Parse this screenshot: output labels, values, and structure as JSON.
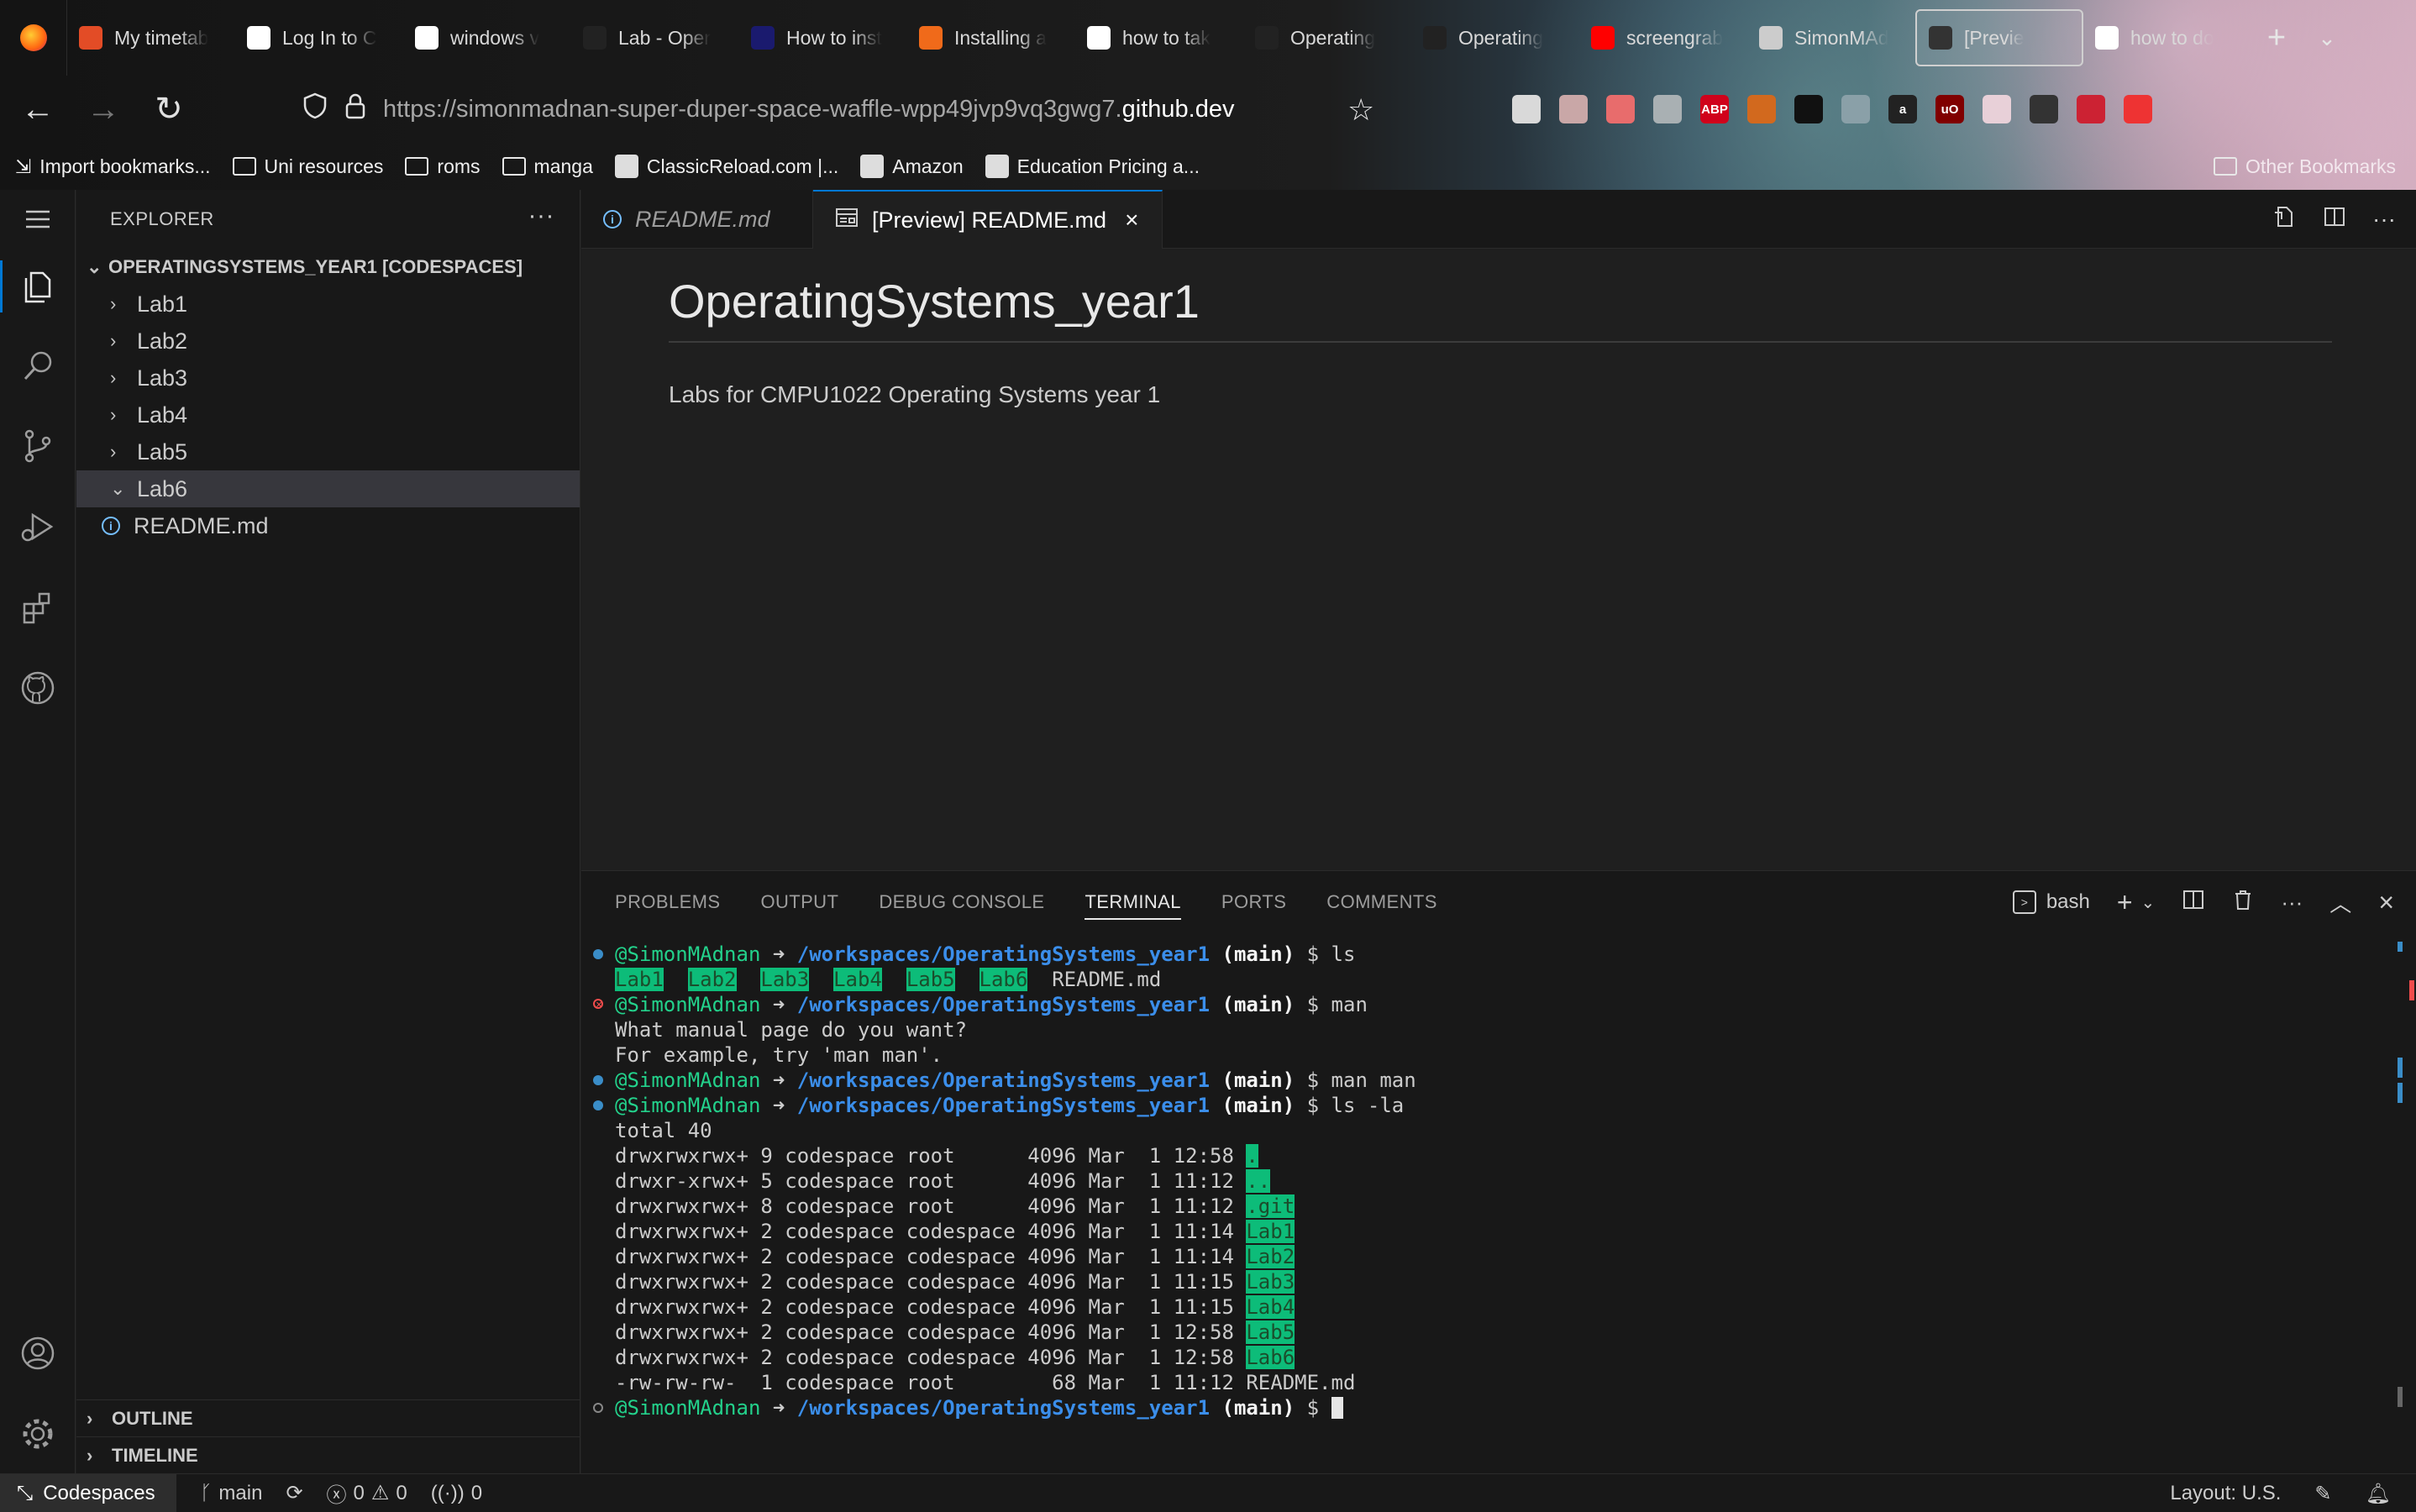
{
  "browser": {
    "tabs": [
      {
        "title": "My timetab",
        "icon": "red-bird-icon",
        "color": "#e34c26"
      },
      {
        "title": "Log In to C",
        "icon": "cisco-icon",
        "color": "#ffffff"
      },
      {
        "title": "windows v",
        "icon": "google-icon",
        "color": "#ffffff"
      },
      {
        "title": "Lab - Oper",
        "icon": "d2l-icon",
        "color": "#222222"
      },
      {
        "title": "How to inst",
        "icon": "arch-icon",
        "color": "#1a1a6e"
      },
      {
        "title": "Installing a",
        "icon": "chevron-logo-icon",
        "color": "#f06a1a"
      },
      {
        "title": "how to tak",
        "icon": "google-icon",
        "color": "#ffffff"
      },
      {
        "title": "Operating",
        "icon": "d2l-icon",
        "color": "#222222"
      },
      {
        "title": "Operating",
        "icon": "d2l-icon",
        "color": "#222222"
      },
      {
        "title": "screengrab",
        "icon": "youtube-icon",
        "color": "#ff0000"
      },
      {
        "title": "SimonMAd",
        "icon": "search-icon",
        "color": "#cccccc"
      },
      {
        "title": "[Previe",
        "icon": "github-icon",
        "color": "#333333"
      },
      {
        "title": "how to do",
        "icon": "google-icon",
        "color": "#ffffff"
      }
    ],
    "url_dim": "https://simonmadnan-super-duper-space-waffle-wpp49jvp9vq3gwg7.",
    "url_bright": "github.dev",
    "bookmarks": [
      {
        "label": "Import bookmarks...",
        "type": "import"
      },
      {
        "label": "Uni resources",
        "type": "folder"
      },
      {
        "label": "roms",
        "type": "folder"
      },
      {
        "label": "manga",
        "type": "folder"
      },
      {
        "label": "ClassicReload.com |...",
        "type": "site"
      },
      {
        "label": "Amazon",
        "type": "site"
      },
      {
        "label": "Education Pricing a...",
        "type": "site"
      }
    ],
    "other_bookmarks": "Other Bookmarks",
    "extensions": [
      {
        "label": "",
        "color": "#d9d9d9"
      },
      {
        "label": "",
        "color": "#c9a7a7"
      },
      {
        "label": "",
        "color": "#e86c6c"
      },
      {
        "label": "",
        "color": "#a9b0b3"
      },
      {
        "label": "ABP",
        "color": "#d0021b"
      },
      {
        "label": "",
        "color": "#d2691e"
      },
      {
        "label": "",
        "color": "#111111"
      },
      {
        "label": "",
        "color": "#8aa0a8"
      },
      {
        "label": "a",
        "color": "#222222"
      },
      {
        "label": "uO",
        "color": "#800000"
      },
      {
        "label": "",
        "color": "#e8d0d8"
      },
      {
        "label": "",
        "color": "#333333"
      },
      {
        "label": "",
        "color": "#cc2233"
      },
      {
        "label": "",
        "color": "#e33"
      }
    ]
  },
  "sidebar": {
    "title": "EXPLORER",
    "root": "OPERATINGSYSTEMS_YEAR1 [CODESPACES]",
    "items": [
      {
        "label": "Lab1",
        "expanded": false
      },
      {
        "label": "Lab2",
        "expanded": false
      },
      {
        "label": "Lab3",
        "expanded": false
      },
      {
        "label": "Lab4",
        "expanded": false
      },
      {
        "label": "Lab5",
        "expanded": false
      },
      {
        "label": "Lab6",
        "expanded": true
      }
    ],
    "file": "README.md",
    "outline": "OUTLINE",
    "timeline": "TIMELINE"
  },
  "editor": {
    "tabs": [
      {
        "label": "README.md",
        "active": false
      },
      {
        "label": "[Preview] README.md",
        "active": true
      }
    ],
    "preview_title": "OperatingSystems_year1",
    "preview_text": "Labs for CMPU1022 Operating Systems year 1"
  },
  "panel": {
    "tabs": [
      "PROBLEMS",
      "OUTPUT",
      "DEBUG CONSOLE",
      "TERMINAL",
      "PORTS",
      "COMMENTS"
    ],
    "active_tab": "TERMINAL",
    "shell": "bash"
  },
  "terminal": {
    "user": "@SimonMAdnan",
    "arrow": "➜",
    "path": "/workspaces/OperatingSystems_year1",
    "branch": "main",
    "dirs": [
      "Lab1",
      "Lab2",
      "Lab3",
      "Lab4",
      "Lab5",
      "Lab6"
    ],
    "readme": "README.md",
    "cmd_ls": "ls",
    "cmd_man": "man",
    "man_out_1": "What manual page do you want?",
    "man_out_2": "For example, try 'man man'.",
    "cmd_man_man": "man man",
    "cmd_ls_la": "ls -la",
    "total": "total 40",
    "listing": [
      {
        "perm": "drwxrwxrwx+ 9 codespace root      4096 Mar  1 12:58 ",
        "name": ".",
        "dir": true
      },
      {
        "perm": "drwxr-xrwx+ 5 codespace root      4096 Mar  1 11:12 ",
        "name": "..",
        "dir": true
      },
      {
        "perm": "drwxrwxrwx+ 8 codespace root      4096 Mar  1 11:12 ",
        "name": ".git",
        "dir": true
      },
      {
        "perm": "drwxrwxrwx+ 2 codespace codespace 4096 Mar  1 11:14 ",
        "name": "Lab1",
        "dir": true
      },
      {
        "perm": "drwxrwxrwx+ 2 codespace codespace 4096 Mar  1 11:14 ",
        "name": "Lab2",
        "dir": true
      },
      {
        "perm": "drwxrwxrwx+ 2 codespace codespace 4096 Mar  1 11:15 ",
        "name": "Lab3",
        "dir": true
      },
      {
        "perm": "drwxrwxrwx+ 2 codespace codespace 4096 Mar  1 11:15 ",
        "name": "Lab4",
        "dir": true
      },
      {
        "perm": "drwxrwxrwx+ 2 codespace codespace 4096 Mar  1 12:58 ",
        "name": "Lab5",
        "dir": true
      },
      {
        "perm": "drwxrwxrwx+ 2 codespace codespace 4096 Mar  1 12:58 ",
        "name": "Lab6",
        "dir": true
      },
      {
        "perm": "-rw-rw-rw-  1 codespace root        68 Mar  1 11:12 ",
        "name": "README.md",
        "dir": false
      }
    ]
  },
  "status": {
    "remote": "Codespaces",
    "branch": "main",
    "errors": "0",
    "warnings": "0",
    "ports": "0",
    "layout": "Layout: U.S."
  },
  "colors": {
    "accent": "#0078d4",
    "terminal_dir_bg": "#0dbc79",
    "prompt_user": "#23d18b",
    "prompt_path": "#3b8eea",
    "error": "#f14c4c"
  }
}
